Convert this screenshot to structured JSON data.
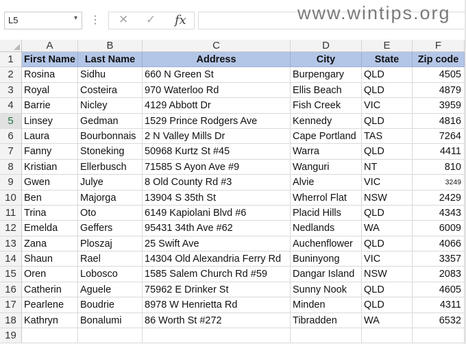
{
  "formula_bar": {
    "name_box": "L5",
    "name_box_arrow": "▾",
    "separator": "⋮",
    "cancel_symbol": "✕",
    "enter_symbol": "✓",
    "fx_label": "fx",
    "formula_value": ""
  },
  "watermark": "www.wintips.org",
  "grid": {
    "columns": [
      "A",
      "B",
      "C",
      "D",
      "E",
      "F"
    ],
    "active_row": 5,
    "header_fill_color": "#b4c6e7",
    "header_row": {
      "row_number": "1",
      "first_name": "First Name",
      "last_name": "Last Name",
      "address": "Address",
      "city": "City",
      "state": "State",
      "zip": "Zip code"
    },
    "rows": [
      {
        "row_number": "2",
        "first_name": "Rosina",
        "last_name": "Sidhu",
        "address": "660 N Green St",
        "city": "Burpengary",
        "state": "QLD",
        "zip": "4505"
      },
      {
        "row_number": "3",
        "first_name": "Royal",
        "last_name": "Costeira",
        "address": "970 Waterloo Rd",
        "city": "Ellis Beach",
        "state": "QLD",
        "zip": "4879"
      },
      {
        "row_number": "4",
        "first_name": "Barrie",
        "last_name": "Nicley",
        "address": "4129 Abbott Dr",
        "city": "Fish Creek",
        "state": "VIC",
        "zip": "3959"
      },
      {
        "row_number": "5",
        "first_name": "Linsey",
        "last_name": "Gedman",
        "address": "1529 Prince Rodgers Ave",
        "city": "Kennedy",
        "state": "QLD",
        "zip": "4816"
      },
      {
        "row_number": "6",
        "first_name": "Laura",
        "last_name": "Bourbonnais",
        "address": "2 N Valley Mills Dr",
        "city": "Cape Portland",
        "state": "TAS",
        "zip": "7264"
      },
      {
        "row_number": "7",
        "first_name": "Fanny",
        "last_name": "Stoneking",
        "address": "50968 Kurtz St #45",
        "city": "Warra",
        "state": "QLD",
        "zip": "4411"
      },
      {
        "row_number": "8",
        "first_name": "Kristian",
        "last_name": "Ellerbusch",
        "address": "71585 S Ayon Ave #9",
        "city": "Wanguri",
        "state": "NT",
        "zip": "810"
      },
      {
        "row_number": "9",
        "first_name": "Gwen",
        "last_name": "Julye",
        "address": "8 Old County Rd #3",
        "city": "Alvie",
        "state": "VIC",
        "zip": "3249"
      },
      {
        "row_number": "10",
        "first_name": "Ben",
        "last_name": "Majorga",
        "address": "13904 S 35th St",
        "city": "Wherrol Flat",
        "state": "NSW",
        "zip": "2429"
      },
      {
        "row_number": "11",
        "first_name": "Trina",
        "last_name": "Oto",
        "address": "6149 Kapiolani Blvd #6",
        "city": "Placid Hills",
        "state": "QLD",
        "zip": "4343"
      },
      {
        "row_number": "12",
        "first_name": "Emelda",
        "last_name": "Geffers",
        "address": "95431 34th Ave #62",
        "city": "Nedlands",
        "state": "WA",
        "zip": "6009"
      },
      {
        "row_number": "13",
        "first_name": "Zana",
        "last_name": "Ploszaj",
        "address": "25 Swift Ave",
        "city": "Auchenflower",
        "state": "QLD",
        "zip": "4066"
      },
      {
        "row_number": "14",
        "first_name": "Shaun",
        "last_name": "Rael",
        "address": "14304 Old Alexandria Ferry Rd",
        "city": "Buninyong",
        "state": "VIC",
        "zip": "3357"
      },
      {
        "row_number": "15",
        "first_name": "Oren",
        "last_name": "Lobosco",
        "address": "1585 Salem Church Rd #59",
        "city": "Dangar Island",
        "state": "NSW",
        "zip": "2083"
      },
      {
        "row_number": "16",
        "first_name": "Catherin",
        "last_name": "Aguele",
        "address": "75962 E Drinker St",
        "city": "Sunny Nook",
        "state": "QLD",
        "zip": "4605"
      },
      {
        "row_number": "17",
        "first_name": "Pearlene",
        "last_name": "Boudrie",
        "address": "8978 W Henrietta Rd",
        "city": "Minden",
        "state": "QLD",
        "zip": "4311"
      },
      {
        "row_number": "18",
        "first_name": "Kathryn",
        "last_name": "Bonalumi",
        "address": "86 Worth St #272",
        "city": "Tibradden",
        "state": "WA",
        "zip": "6532"
      }
    ],
    "empty_row_number": "19"
  }
}
